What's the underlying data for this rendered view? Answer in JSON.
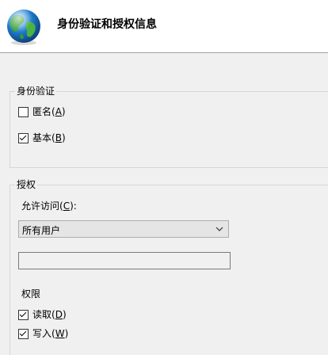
{
  "header": {
    "title": "身份验证和授权信息",
    "icon": "globe-icon"
  },
  "authentication": {
    "legend": "身份验证",
    "anonymous": {
      "label": "匿名",
      "accel_open": "(",
      "accel_key": "A",
      "accel_close": ")",
      "checked": false
    },
    "basic": {
      "label": "基本",
      "accel_open": "(",
      "accel_key": "B",
      "accel_close": ")",
      "checked": true
    }
  },
  "authorization": {
    "legend": "授权",
    "allow_access": {
      "label": "允许访问",
      "accel_open": "(",
      "accel_key": "C",
      "accel_close": "):"
    },
    "select": {
      "value": "所有用户",
      "icon": "chevron-down-icon"
    },
    "textbox": {
      "value": ""
    },
    "permissions_label": "权限",
    "read": {
      "label": "读取",
      "accel_open": "(",
      "accel_key": "D",
      "accel_close": ")",
      "checked": true
    },
    "write": {
      "label": "写入",
      "accel_open": "(",
      "accel_key": "W",
      "accel_close": ")",
      "checked": true
    }
  }
}
